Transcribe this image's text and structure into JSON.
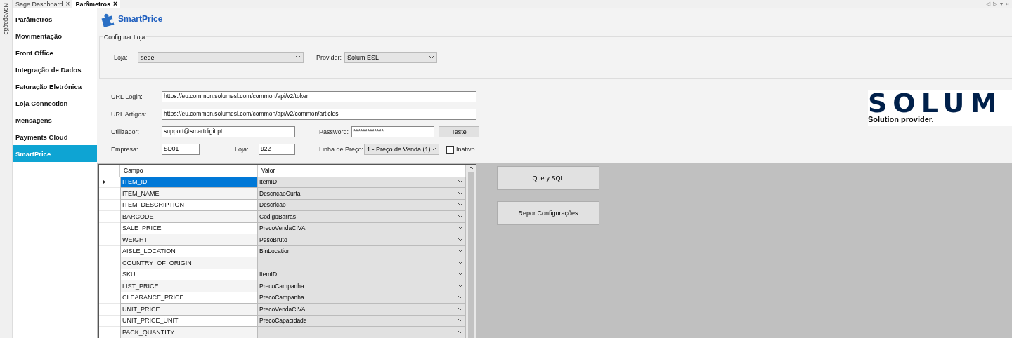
{
  "nav_strip": {
    "title": "Navegação"
  },
  "tabs": [
    {
      "label": "Sage Dashboard",
      "close": "×",
      "selected": false
    },
    {
      "label": "Parâmetros",
      "close": "×",
      "selected": true
    }
  ],
  "tab_controls": [
    "◁",
    "▷",
    "▾",
    "×"
  ],
  "sidebar": {
    "items": [
      {
        "label": "Parâmetros",
        "selected": false
      },
      {
        "label": "Movimentação",
        "selected": false
      },
      {
        "label": "Front Office",
        "selected": false
      },
      {
        "label": "Integração de Dados",
        "selected": false
      },
      {
        "label": "Faturação Eletrónica",
        "selected": false
      },
      {
        "label": "Loja Connection",
        "selected": false
      },
      {
        "label": "Mensagens",
        "selected": false
      },
      {
        "label": "Payments Cloud",
        "selected": false
      },
      {
        "label": "SmartPrice",
        "selected": true
      }
    ]
  },
  "header": {
    "title": "SmartPrice"
  },
  "store_group": {
    "title": "Configurar Loja",
    "loja_label": "Loja:",
    "loja_value": "sede",
    "provider_label": "Provider:",
    "provider_value": "Solum ESL"
  },
  "form": {
    "url_login_label": "URL Login:",
    "url_login": "https://eu.common.solumesl.com/common/api/v2/token",
    "url_artigos_label": "URL Artigos:",
    "url_artigos": "https://eu.common.solumesl.com/common/api/v2/common/articles",
    "user_label": "Utilizador:",
    "user": "support@smartdigit.pt",
    "password_label": "Password:",
    "password": "*************",
    "test_button": "Teste",
    "empresa_label": "Empresa:",
    "empresa": "SD01",
    "loja_label": "Loja:",
    "loja": "922",
    "price_line_label": "Linha de Preço:",
    "price_line": "1 - Preço de Venda (1)",
    "inactive_label": "Inativo",
    "inactive": false
  },
  "logo": {
    "name": "SOLUM",
    "tagline": "Solution provider."
  },
  "table": {
    "columns": [
      "Campo",
      "Valor"
    ],
    "rows": [
      {
        "campo": "ITEM_ID",
        "valor": "ItemID",
        "selected": true
      },
      {
        "campo": "ITEM_NAME",
        "valor": "DescricaoCurta",
        "selected": false
      },
      {
        "campo": "ITEM_DESCRIPTION",
        "valor": "Descricao",
        "selected": false
      },
      {
        "campo": "BARCODE",
        "valor": "CodigoBarras",
        "selected": false
      },
      {
        "campo": "SALE_PRICE",
        "valor": "PrecoVendaCIVA",
        "selected": false
      },
      {
        "campo": "WEIGHT",
        "valor": "PesoBruto",
        "selected": false
      },
      {
        "campo": "AISLE_LOCATION",
        "valor": "BinLocation",
        "selected": false
      },
      {
        "campo": "COUNTRY_OF_ORIGIN",
        "valor": "",
        "selected": false
      },
      {
        "campo": "SKU",
        "valor": "ItemID",
        "selected": false
      },
      {
        "campo": "LIST_PRICE",
        "valor": "PrecoCampanha",
        "selected": false
      },
      {
        "campo": "CLEARANCE_PRICE",
        "valor": "PrecoCampanha",
        "selected": false
      },
      {
        "campo": "UNIT_PRICE",
        "valor": "PrecoVendaCIVA",
        "selected": false
      },
      {
        "campo": "UNIT_PRICE_UNIT",
        "valor": "PrecoCapacidade",
        "selected": false
      },
      {
        "campo": "PACK_QUANTITY",
        "valor": "",
        "selected": false
      }
    ]
  },
  "buttons": [
    "Query SQL",
    "Repor Configurações"
  ]
}
